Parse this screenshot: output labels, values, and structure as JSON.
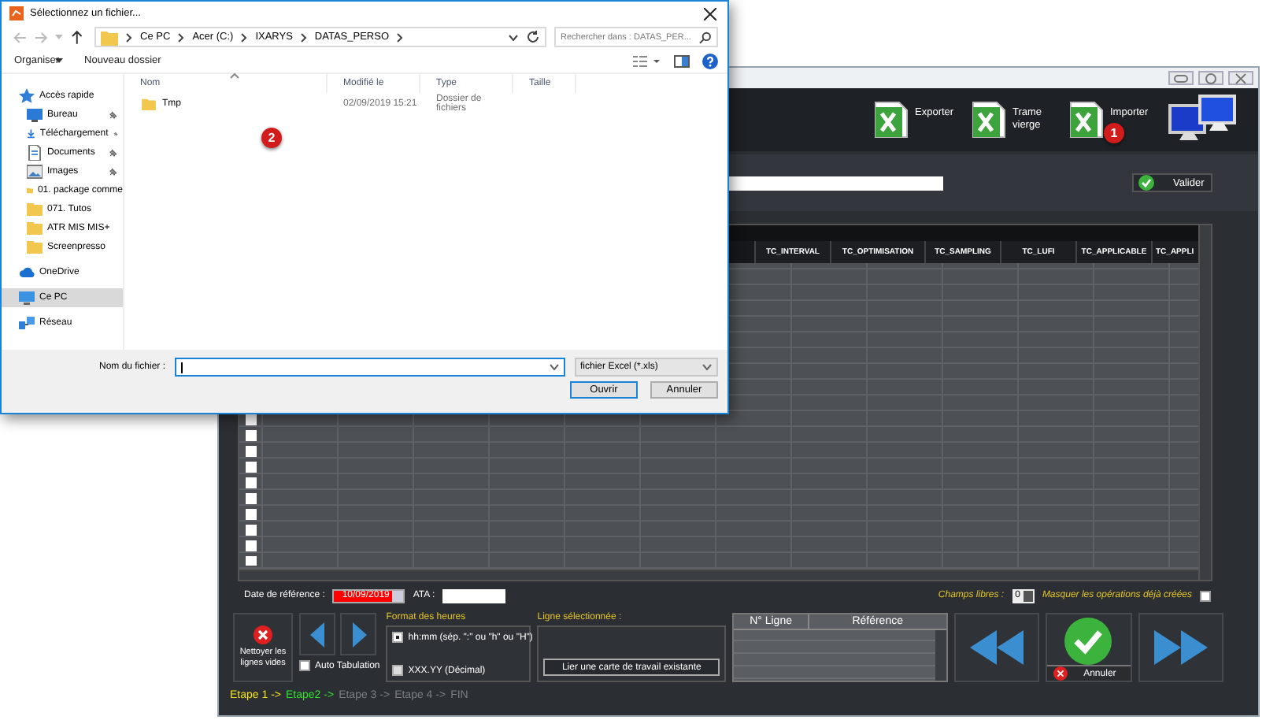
{
  "app": {
    "tools": [
      {
        "label": "Exporter",
        "kind": "excel"
      },
      {
        "label": "Trame vierge",
        "kind": "excel"
      },
      {
        "label": "Importer",
        "kind": "excel",
        "badge": "1"
      },
      {
        "kind": "monitors"
      }
    ],
    "validate_button": "Valider",
    "grid": {
      "columns": [
        "TC_INTERVAL",
        "TC_OPTIMISATION",
        "TC_SAMPLING",
        "TC_LUFI",
        "TC_APPLICABLE",
        "TC_APPLI"
      ]
    },
    "reference_date": {
      "label": "Date de référence :",
      "value": "10/09/2019"
    },
    "ata": {
      "label": "ATA :"
    },
    "free_fields": {
      "label": "Champs libres :",
      "value": "0"
    },
    "hide_created": {
      "label": "Masquer les opérations déjà créées",
      "checked": false
    },
    "clean_button": "Nettoyer les lignes vides",
    "auto_tab": {
      "label": "Auto Tabulation",
      "checked": false
    },
    "time_format": {
      "title": "Format des heures",
      "options": [
        {
          "label": "hh:mm (sép. \":\" ou \"h\" ou \"H\")",
          "selected": true
        },
        {
          "label": "XXX.YY (Décimal)",
          "selected": false
        }
      ]
    },
    "selected_line": {
      "title": "Ligne sélectionnée :",
      "button": "Lier une carte de travail existante"
    },
    "mini_grid": {
      "columns": [
        "N° Ligne",
        "Référence"
      ]
    },
    "cancel_button": "Annuler",
    "steps": [
      {
        "label": "Etape 1 ->",
        "done": true,
        "current": false
      },
      {
        "label": "Etape2 ->",
        "done": false,
        "current": true
      },
      {
        "label": "Etape 3 ->",
        "done": false,
        "current": false
      },
      {
        "label": "Etape 4 ->",
        "done": false,
        "current": false
      },
      {
        "label": "FIN",
        "done": false,
        "current": false
      }
    ]
  },
  "dialog": {
    "title": "Sélectionnez un fichier...",
    "path": [
      "Ce PC",
      "Acer (C:)",
      "IXARYS",
      "DATAS_PERSO"
    ],
    "search": {
      "placeholder": "Rechercher dans : DATAS_PER..."
    },
    "toolbar": [
      "Organiser",
      "Nouveau dossier"
    ],
    "sidebar": [
      {
        "label": "Accès rapide",
        "kind": "star",
        "selected": false,
        "children": [
          {
            "label": "Bureau",
            "kind": "desktop",
            "pinned": true,
            "selected": false
          },
          {
            "label": "Téléchargement",
            "kind": "download",
            "pinned": true,
            "selected": false
          },
          {
            "label": "Documents",
            "kind": "document",
            "pinned": true,
            "selected": false
          },
          {
            "label": "Images",
            "kind": "image",
            "pinned": true,
            "selected": false
          },
          {
            "label": "01. package comme",
            "kind": "folder",
            "pinned": false,
            "selected": false
          },
          {
            "label": "071. Tutos",
            "kind": "folder",
            "pinned": false,
            "selected": false
          },
          {
            "label": "ATR MIS MIS+",
            "kind": "folder",
            "pinned": false,
            "selected": false
          },
          {
            "label": "Screenpresso",
            "kind": "folder",
            "pinned": false,
            "selected": false
          }
        ]
      },
      {
        "label": "OneDrive",
        "kind": "cloud",
        "selected": false
      },
      {
        "label": "Ce PC",
        "kind": "pc",
        "selected": true
      },
      {
        "label": "Réseau",
        "kind": "network",
        "selected": false
      }
    ],
    "columns": [
      "Nom",
      "Modifié le",
      "Type",
      "Taille"
    ],
    "files": [
      {
        "name": "Tmp",
        "modified": "02/09/2019 15:21",
        "type": "Dossier de fichiers"
      }
    ],
    "badge": "2",
    "filename": {
      "label": "Nom du fichier :"
    },
    "filetype": "fichier Excel (*.xls)",
    "buttons": [
      "Ouvrir",
      "Annuler"
    ]
  }
}
